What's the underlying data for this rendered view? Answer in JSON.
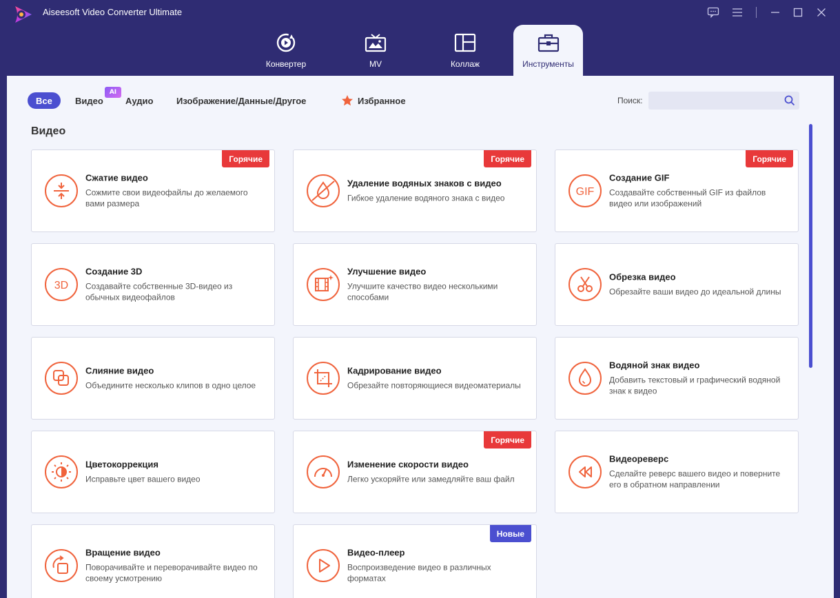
{
  "app": {
    "title": "Aiseesoft Video Converter Ultimate"
  },
  "main_tabs": [
    {
      "label": "Конвертер",
      "icon": "convert-icon"
    },
    {
      "label": "MV",
      "icon": "mv-icon"
    },
    {
      "label": "Коллаж",
      "icon": "collage-icon"
    },
    {
      "label": "Инструменты",
      "icon": "toolbox-icon",
      "active": true
    }
  ],
  "filters": {
    "all": "Все",
    "video": "Видео",
    "ai_badge": "AI",
    "audio": "Аудио",
    "image_data_other": "Изображение/Данные/Другое",
    "favorites": "Избранное"
  },
  "search": {
    "label": "Поиск:",
    "placeholder": "",
    "value": ""
  },
  "section": {
    "title": "Видео"
  },
  "badges": {
    "hot": "Горячие",
    "new": "Новые"
  },
  "tools": [
    {
      "title": "Сжатие видео",
      "desc": "Сожмите свои видеофайлы до желаемого вами размера",
      "icon": "compress-icon",
      "badge": "hot"
    },
    {
      "title": "Удаление водяных знаков с видео",
      "desc": "Гибкое удаление водяного знака с видео",
      "icon": "watermark-remove-icon",
      "badge": "hot"
    },
    {
      "title": "Создание GIF",
      "desc": "Создавайте собственный GIF из файлов видео или изображений",
      "icon": "gif-icon",
      "badge": "hot"
    },
    {
      "title": "Создание 3D",
      "desc": "Создавайте собственные 3D-видео из обычных видеофайлов",
      "icon": "3d-icon",
      "badge": ""
    },
    {
      "title": "Улучшение видео",
      "desc": "Улучшите качество видео несколькими способами",
      "icon": "enhance-icon",
      "badge": ""
    },
    {
      "title": "Обрезка видео",
      "desc": "Обрезайте ваши видео до идеальной длины",
      "icon": "scissors-icon",
      "badge": ""
    },
    {
      "title": "Слияние видео",
      "desc": "Объедините несколько клипов в одно целое",
      "icon": "merge-icon",
      "badge": ""
    },
    {
      "title": "Кадрирование видео",
      "desc": "Обрезайте повторяющиеся видеоматериалы",
      "icon": "crop-icon",
      "badge": ""
    },
    {
      "title": "Водяной знак видео",
      "desc": "Добавить текстовый и графический водяной знак к видео",
      "icon": "watermark-icon",
      "badge": ""
    },
    {
      "title": "Цветокоррекция",
      "desc": "Исправьте цвет вашего видео",
      "icon": "color-correction-icon",
      "badge": ""
    },
    {
      "title": "Изменение скорости видео",
      "desc": "Легко ускоряйте или замедляйте ваш файл",
      "icon": "speed-icon",
      "badge": "hot"
    },
    {
      "title": "Видеореверс",
      "desc": "Сделайте реверс вашего видео и поверните его в обратном направлении",
      "icon": "reverse-icon",
      "badge": ""
    },
    {
      "title": "Вращение видео",
      "desc": "Поворачивайте и переворачивайте видео по своему усмотрению",
      "icon": "rotate-icon",
      "badge": ""
    },
    {
      "title": "Видео-плеер",
      "desc": "Воспроизведение видео в различных форматах",
      "icon": "play-icon",
      "badge": "new"
    }
  ],
  "colors": {
    "accent": "#4b4fd0",
    "header": "#2f2c73",
    "icon_orange": "#f0633c",
    "hot_badge": "#e8393a",
    "content_bg": "#f3f5fc"
  }
}
